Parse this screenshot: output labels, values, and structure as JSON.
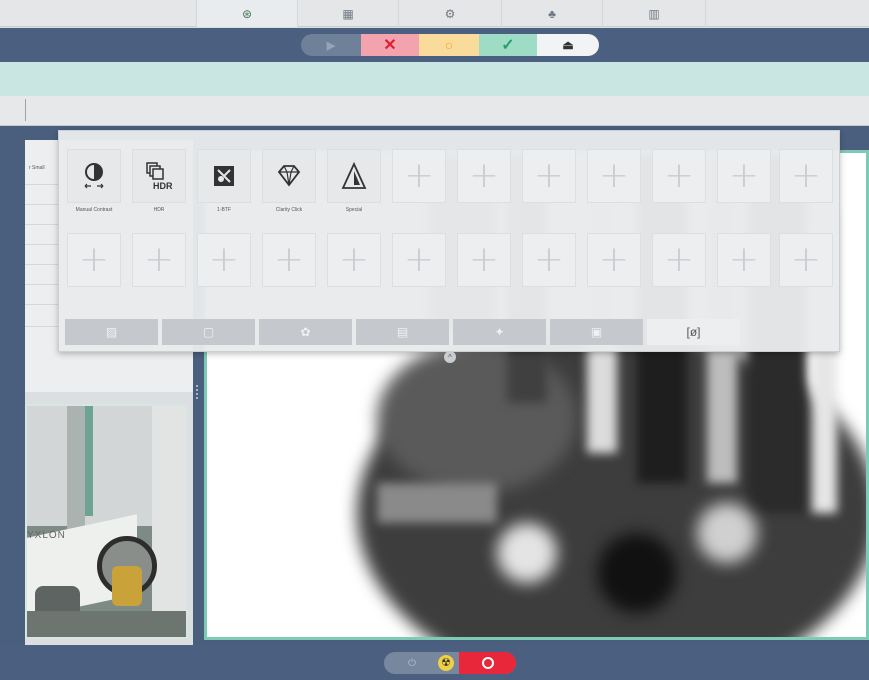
{
  "top_tabs": [
    {
      "icon": "target-icon",
      "glyph": "⊛"
    },
    {
      "icon": "layout-icon",
      "glyph": "▦"
    },
    {
      "icon": "settings-sliders-icon",
      "glyph": "⚙"
    },
    {
      "icon": "user-tools-icon",
      "glyph": "♣"
    },
    {
      "icon": "building-icon",
      "glyph": "▥"
    }
  ],
  "controls": {
    "play": "▶",
    "stop": "✕",
    "pause": "○",
    "ok": "✓",
    "eject": "⏏"
  },
  "left_panel": {
    "label": "r Small"
  },
  "camera": {
    "brand": "YXLON"
  },
  "popup": {
    "tools": [
      {
        "name": "Manual Contrast",
        "icon": "contrast-icon",
        "glyph": "◐"
      },
      {
        "name": "HDR",
        "icon": "hdr-icon",
        "glyph": "HDR"
      },
      {
        "name": "1-BTF",
        "icon": "btf-icon",
        "glyph": "◪"
      },
      {
        "name": "Clarity Click",
        "icon": "diamond-icon",
        "glyph": "◇"
      },
      {
        "name": "Special",
        "icon": "triangle-icon",
        "glyph": "△"
      }
    ],
    "empty_slot_glyph": "+",
    "tabs": [
      {
        "icon": "image-icon",
        "glyph": "▨"
      },
      {
        "icon": "square-icon",
        "glyph": "▢"
      },
      {
        "icon": "gear-icon",
        "glyph": "✿"
      },
      {
        "icon": "document-gear-icon",
        "glyph": "▤"
      },
      {
        "icon": "wand-icon",
        "glyph": "✦"
      },
      {
        "icon": "frame-icon",
        "glyph": "▣"
      },
      {
        "icon": "filter-icon",
        "glyph": "[ø]"
      }
    ],
    "collapse": "^"
  },
  "bottom": {
    "standby": "⏻",
    "radiation": "☢"
  },
  "colors": {
    "header": "#4b6080",
    "accent_teal": "#7fcab4",
    "stop_red": "#dd1f2f",
    "pause_yellow": "#f0a522",
    "ok_green": "#25a06b"
  }
}
